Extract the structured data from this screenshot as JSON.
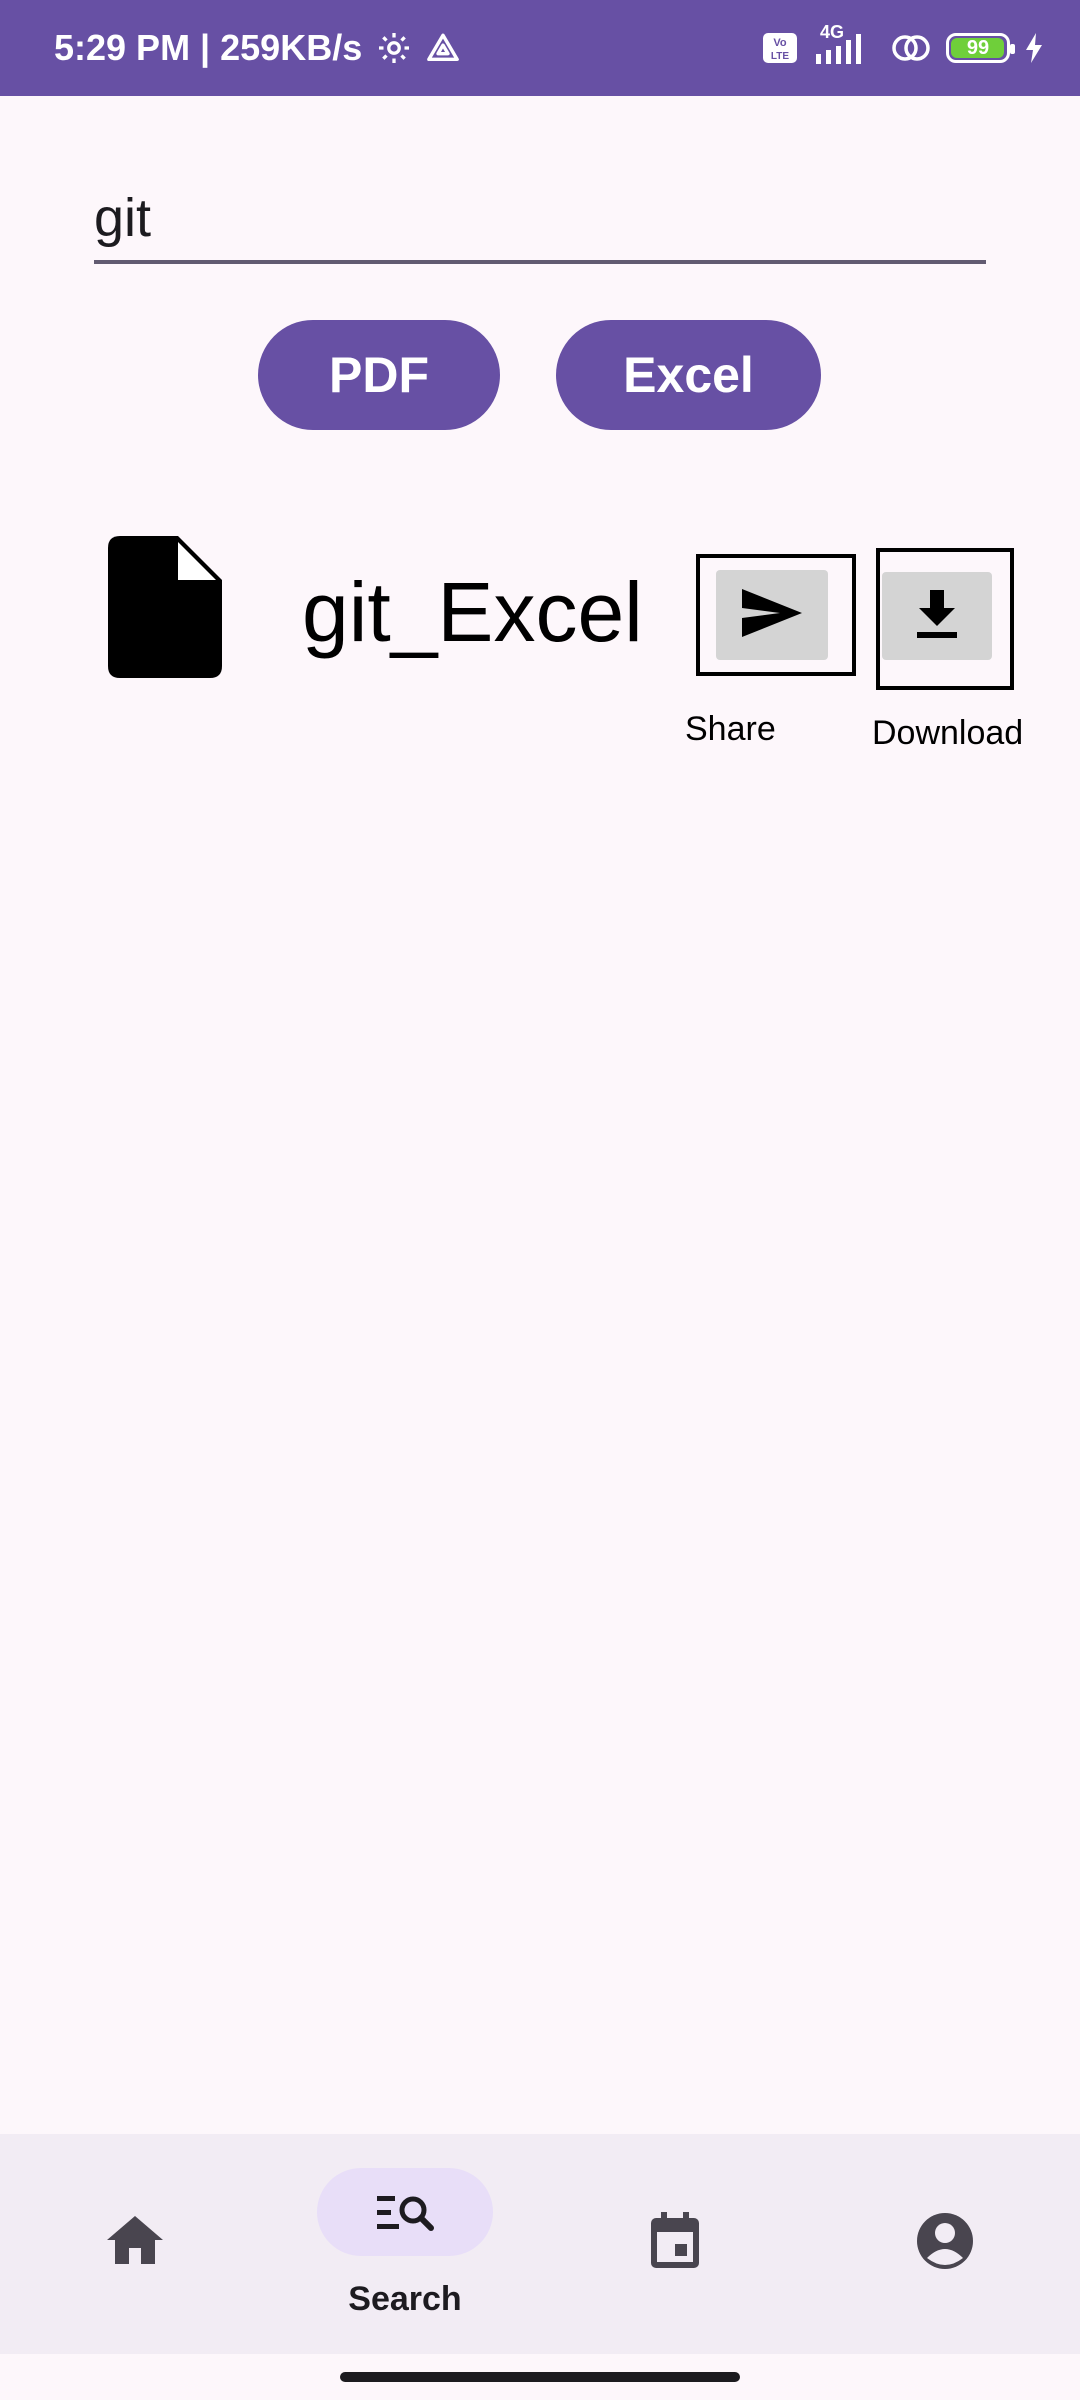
{
  "status_bar": {
    "time_speed": "5:29 PM | 259KB/s",
    "network_type": "4G",
    "battery_level": "99",
    "battery_fraction": 0.99,
    "colors": {
      "background": "#6750a4",
      "battery": "#6fcf3a"
    }
  },
  "search": {
    "value": "git"
  },
  "filters": {
    "pdf_label": "PDF",
    "excel_label": "Excel"
  },
  "results": [
    {
      "name": "git_Excel",
      "share_label": "Share",
      "download_label": "Download"
    }
  ],
  "bottom_nav": {
    "items": [
      {
        "icon": "home-icon",
        "label": ""
      },
      {
        "icon": "search-list-icon",
        "label": "Search",
        "active": true
      },
      {
        "icon": "calendar-icon",
        "label": ""
      },
      {
        "icon": "account-circle-icon",
        "label": ""
      }
    ]
  },
  "colors": {
    "primary": "#6750a4",
    "background": "#fdf7fb",
    "nav_background": "#f2ecf4",
    "nav_active_indicator": "#e8def8"
  }
}
